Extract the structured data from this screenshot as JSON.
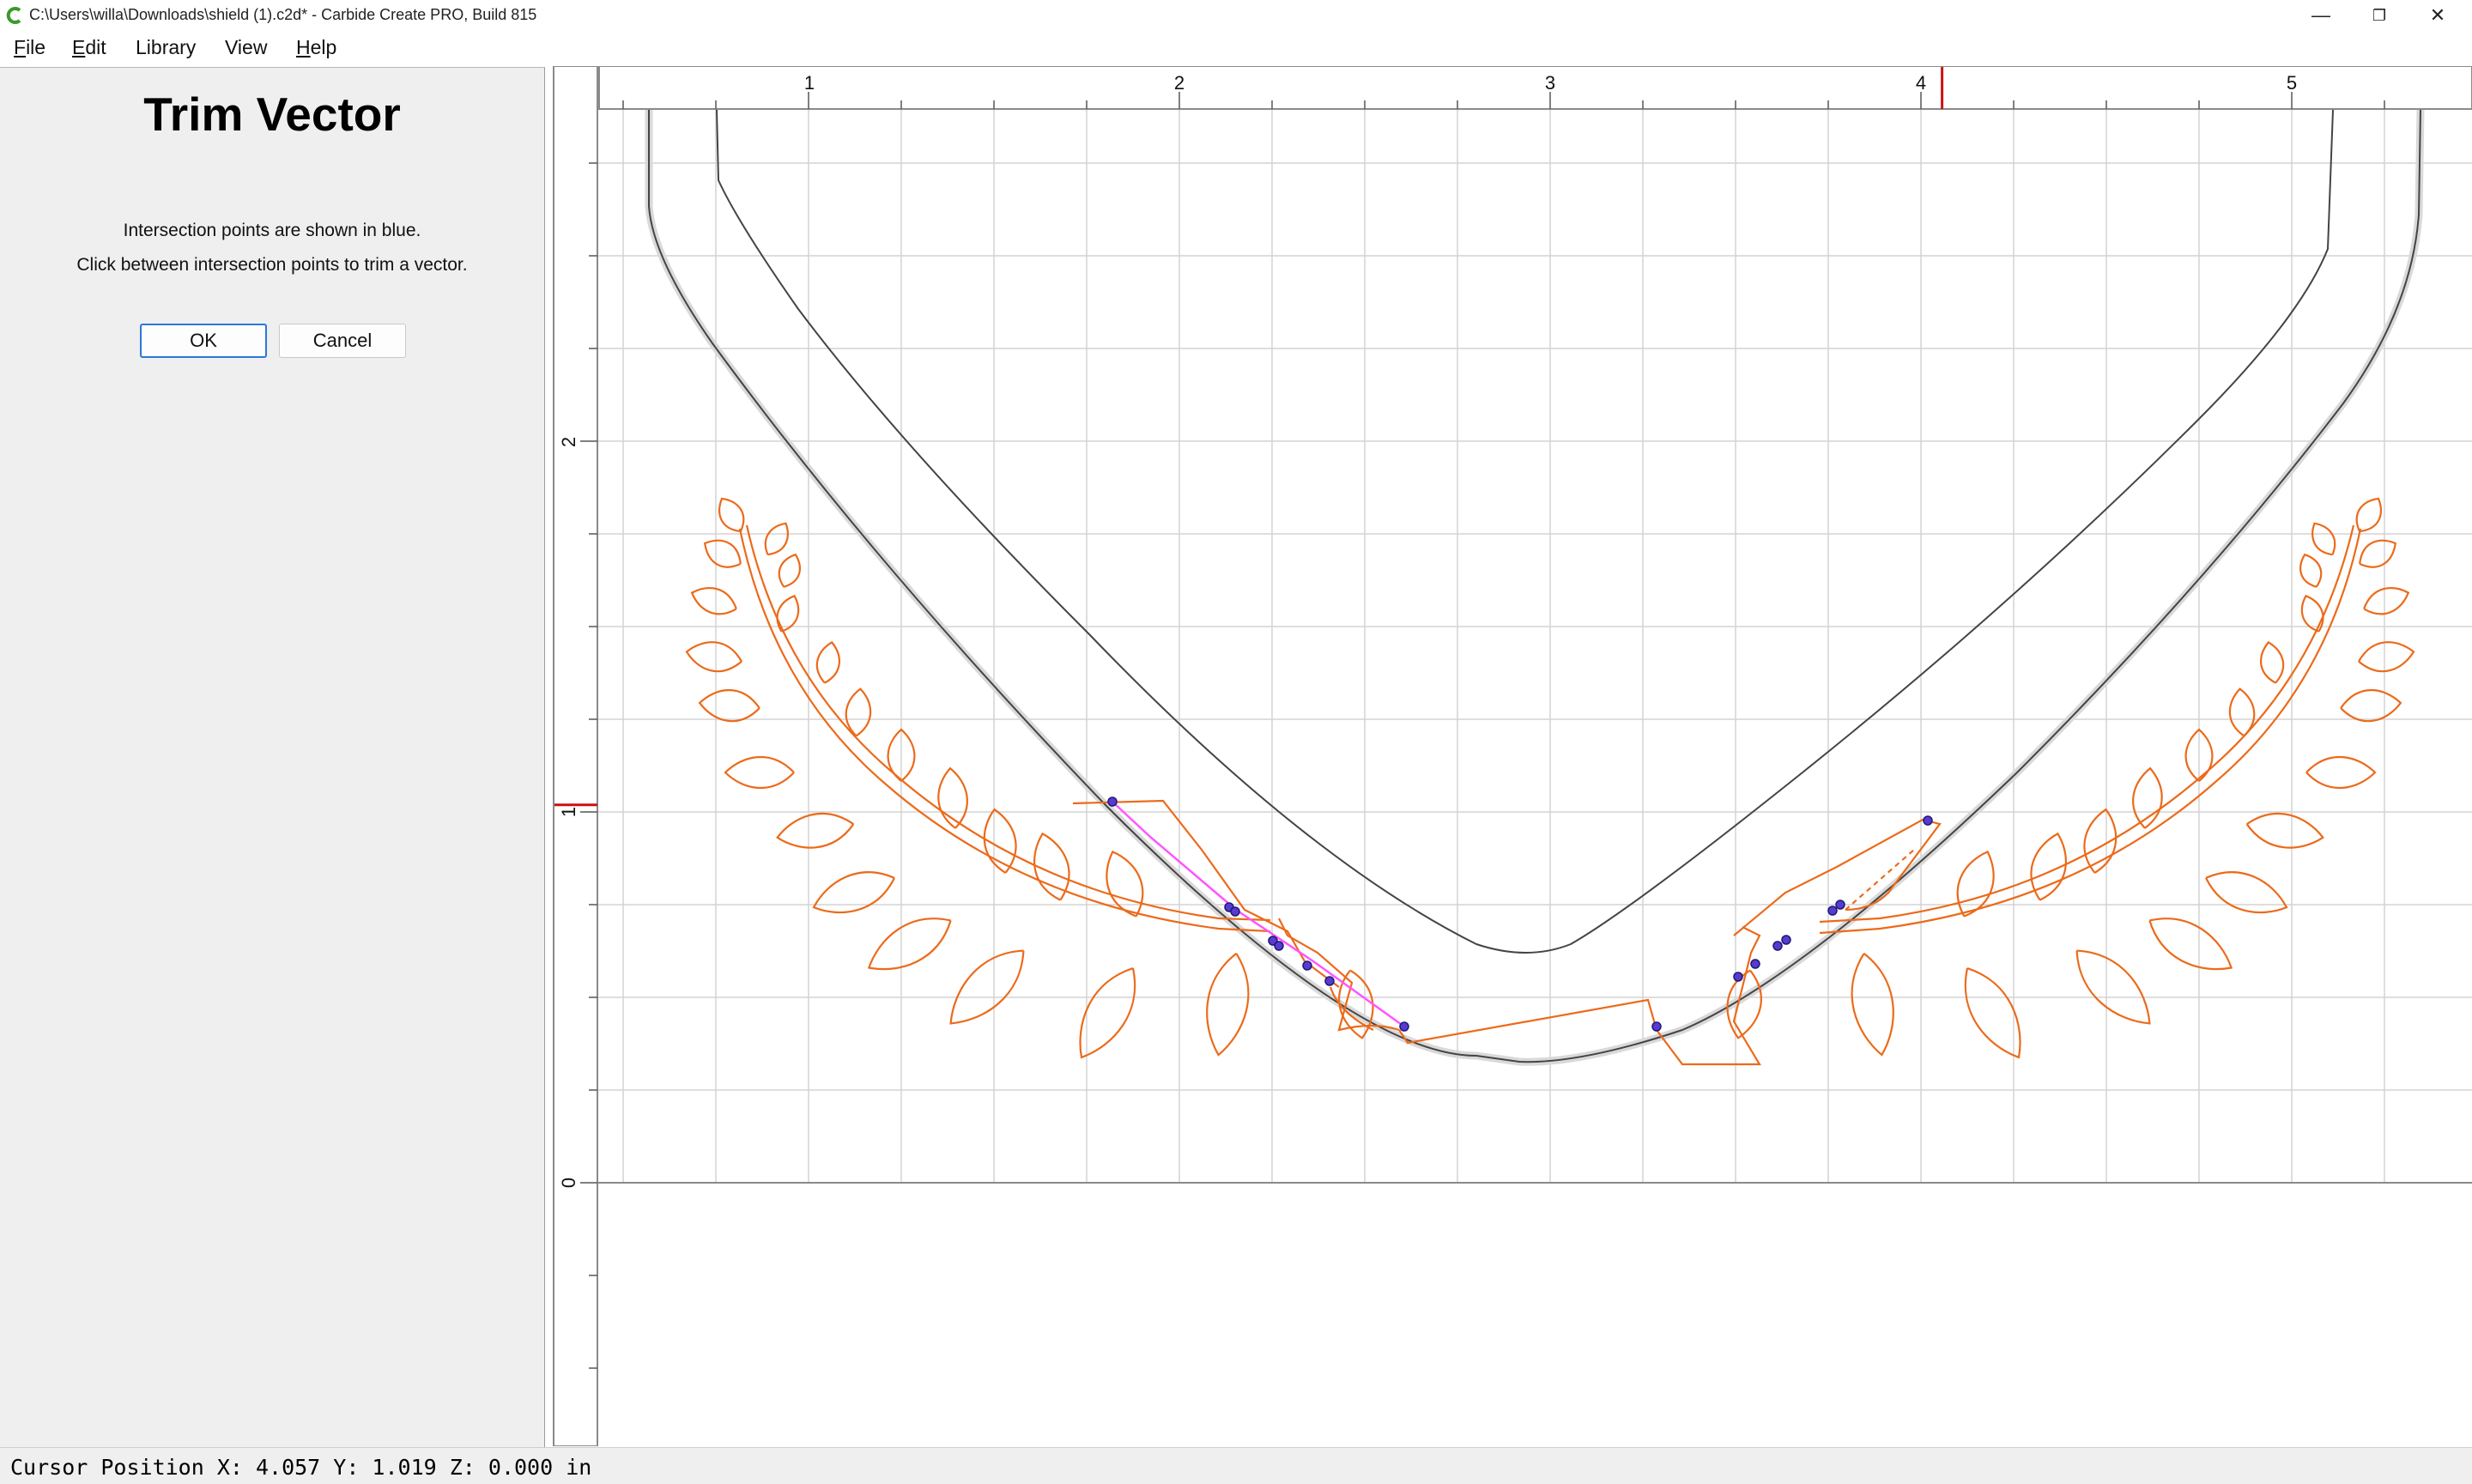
{
  "window": {
    "title": "C:\\Users\\willa\\Downloads\\shield (1).c2d* - Carbide Create PRO, Build 815",
    "controls": {
      "minimize": "—",
      "restore": "❐",
      "close": "✕"
    }
  },
  "menu": [
    {
      "label": "File",
      "accel": "F",
      "rest": "ile"
    },
    {
      "label": "Edit",
      "accel": "E",
      "rest": "dit"
    },
    {
      "label": "Library",
      "accel": "",
      "rest": "Library"
    },
    {
      "label": "View",
      "accel": "",
      "rest": "View"
    },
    {
      "label": "Help",
      "accel": "H",
      "rest": "elp"
    }
  ],
  "panel": {
    "title": "Trim Vector",
    "instruction1": "Intersection points are shown in blue.",
    "instruction2": "Click between intersection points to trim a vector.",
    "ok_label": "OK",
    "cancel_label": "Cancel"
  },
  "rulers": {
    "x_labels": [
      "1",
      "2",
      "3",
      "4",
      "5"
    ],
    "y_labels": [
      "2",
      "1",
      "0"
    ],
    "cursor_x": 4.057,
    "cursor_y": 1.019
  },
  "colors": {
    "vector_orange": "#ec6a1a",
    "shield_line": "#444444",
    "intersection_point": "#3a3adf",
    "trim_highlight": "#ff55ff",
    "ruler_marker": "#cc1111",
    "grid": "#d3d3d3"
  },
  "status": {
    "text": "Cursor Position X: 4.057 Y: 1.019 Z: 0.000 in"
  }
}
